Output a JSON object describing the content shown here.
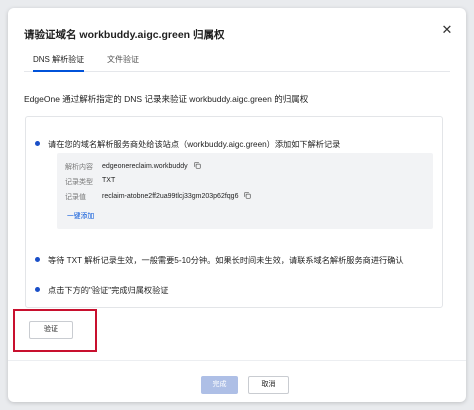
{
  "dialog": {
    "title": "请验证域名 workbuddy.aigc.green 归属权",
    "close_icon": "close-icon"
  },
  "tabs": [
    {
      "label": "DNS 解析验证",
      "active": true
    },
    {
      "label": "文件验证",
      "active": false
    }
  ],
  "description": "EdgeOne 通过解析指定的 DNS 记录来验证 workbuddy.aigc.green 的归属权",
  "steps": {
    "step1": "请在您的域名解析服务商处给该站点（workbuddy.aigc.green）添加如下解析记录",
    "step2": "等待 TXT 解析记录生效，一般需要5-10分钟。如果长时间未生效，请联系域名解析服务商进行确认",
    "step3": "点击下方的\"验证\"完成归属权验证"
  },
  "record": {
    "host_label": "解析内容",
    "host_value": "edgeonereclaim.workbuddy",
    "type_label": "记录类型",
    "type_value": "TXT",
    "value_label": "记录值",
    "value_value": "reclaim-atobne2ff2ua99tlcj33gm203p62fqg6",
    "quick_add": "一键添加"
  },
  "buttons": {
    "verify": "验证",
    "done": "完成",
    "cancel": "取消"
  },
  "colors": {
    "accent": "#0052d9",
    "highlight_border": "#c8102e",
    "done_disabled": "#aebfe6"
  }
}
